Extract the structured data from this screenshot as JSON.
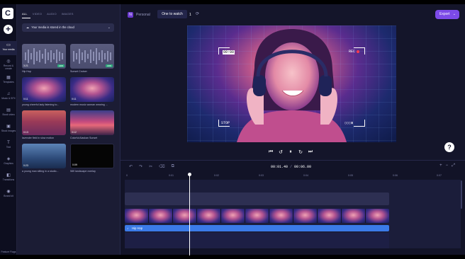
{
  "app": {
    "logo": "C"
  },
  "rail": {
    "items": [
      {
        "icon": "▭",
        "label": "Your media",
        "active": true
      },
      {
        "icon": "◎",
        "label": "Record & create"
      },
      {
        "icon": "▦",
        "label": "Templates"
      },
      {
        "icon": "♫",
        "label": "Music & SFX"
      },
      {
        "icon": "▤",
        "label": "Stock video"
      },
      {
        "icon": "▣",
        "label": "Stock images"
      },
      {
        "icon": "T",
        "label": "Text"
      },
      {
        "icon": "◈",
        "label": "Graphics"
      },
      {
        "icon": "◧",
        "label": "Transitions"
      },
      {
        "icon": "◉",
        "label": "Brand kit"
      }
    ],
    "bottom_label": "Feature Flags"
  },
  "panel": {
    "tabs": [
      "ALL",
      "VIDEO",
      "AUDIO",
      "IMAGES"
    ],
    "cloud_notice": "Your media is stored in the cloud",
    "media": [
      {
        "duration": "3:21",
        "caption": "Hip Hop",
        "badge": "ADD"
      },
      {
        "duration": "",
        "caption": "Sunset Cruiser",
        "badge": "ADD"
      },
      {
        "duration": "0:11",
        "caption": "young cheerful lady listening to...",
        "badge": ""
      },
      {
        "duration": "0:11",
        "caption": "modern music woman wearing ...",
        "badge": ""
      },
      {
        "duration": "0:13",
        "caption": "lavender field in slow motion",
        "badge": ""
      },
      {
        "duration": "0:12",
        "caption": "Colorful Alaskan Sunset",
        "badge": ""
      },
      {
        "duration": "0:23",
        "caption": "a young man sitting in a studio...",
        "badge": ""
      },
      {
        "duration": "0:09",
        "caption": "Wifi landscape overlay",
        "badge": ""
      }
    ]
  },
  "topbar": {
    "workspace_initial": "N",
    "workspace": "Personal",
    "project_name": "One to watch",
    "project_count": "1",
    "export_label": "Export",
    "ratio": "16:9"
  },
  "preview": {
    "top_left": "00:00",
    "rec_label": "REC",
    "stop_label": "STOP",
    "battery": "▯▯▯▮"
  },
  "playback": {
    "timecode_current": "00:01.40",
    "timecode_total": "00:06.00"
  },
  "timeline": {
    "ticks": [
      "0",
      "0:01",
      "0:02",
      "0:03",
      "0:04",
      "0:05",
      "0:06",
      "0:07"
    ],
    "audio_label": "Hip Hop"
  }
}
